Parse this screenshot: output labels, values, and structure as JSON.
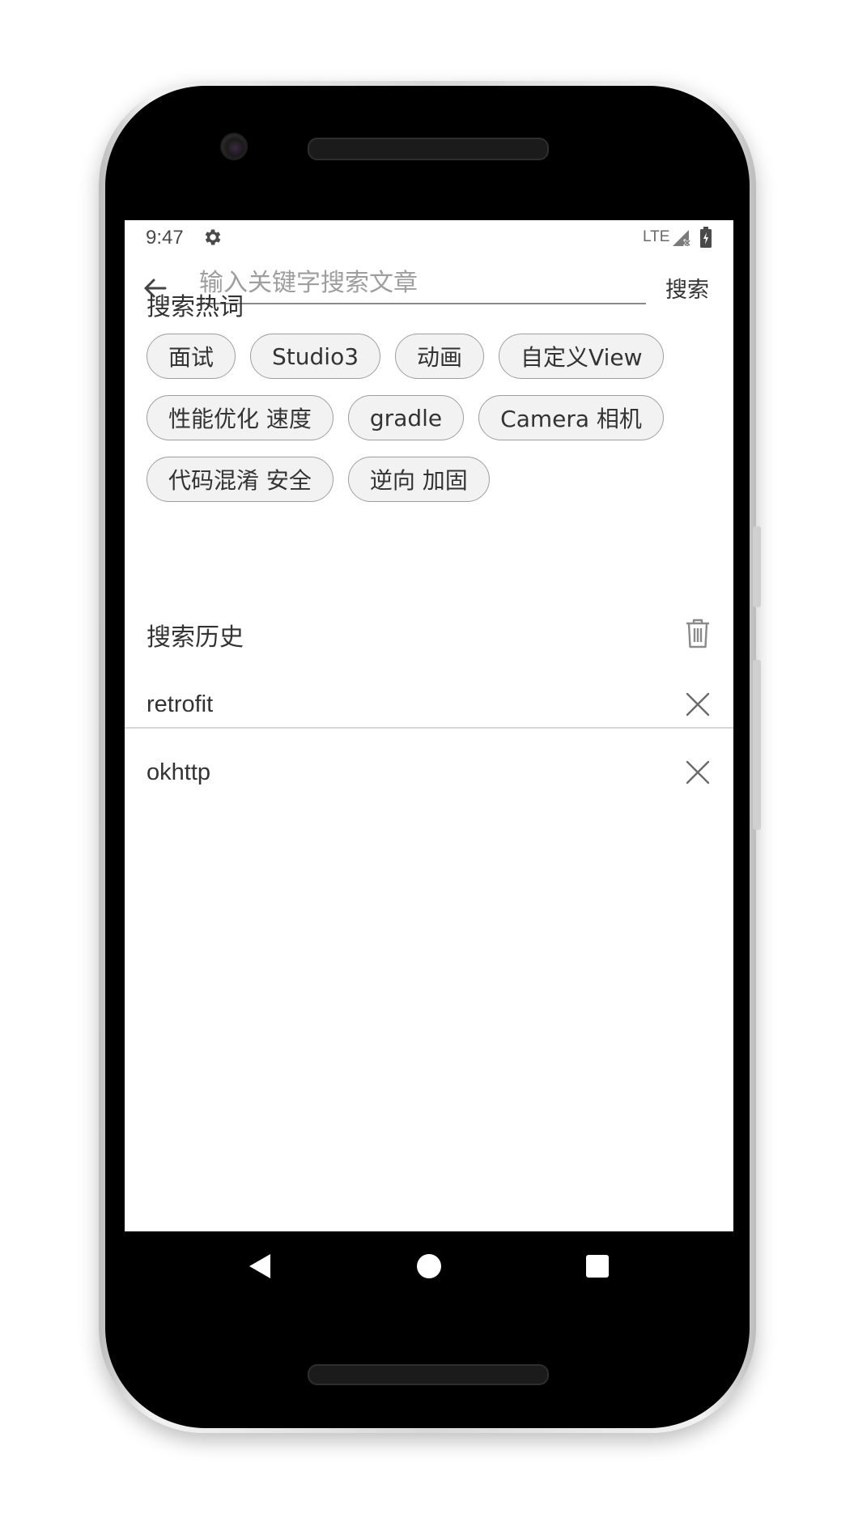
{
  "status_bar": {
    "time": "9:47",
    "network": "LTE",
    "icons": [
      "gear-icon",
      "signal-icon",
      "battery-icon"
    ]
  },
  "toolbar": {
    "back_icon": "arrow-left-icon",
    "search_placeholder": "输入关键字搜索文章",
    "search_value": "",
    "search_label": "搜索"
  },
  "hot_words": {
    "title": "搜索热词",
    "rows": [
      [
        "面试",
        "Studio3",
        "动画",
        "自定义View"
      ],
      [
        "性能优化 速度",
        "gradle",
        "Camera 相机"
      ],
      [
        "代码混淆 安全",
        "逆向 加固"
      ]
    ]
  },
  "history": {
    "title": "搜索历史",
    "clear_icon": "trash-icon",
    "items": [
      {
        "label": "retrofit",
        "remove_icon": "close-icon"
      },
      {
        "label": "okhttp",
        "remove_icon": "close-icon"
      }
    ]
  },
  "navigation_bar": {
    "icons": [
      "back-triangle-icon",
      "home-circle-icon",
      "recents-square-icon"
    ]
  },
  "colors": {
    "chip_background": "#f2f2f2",
    "chip_border": "#9e9e9e",
    "text_primary": "#333333",
    "placeholder": "#9e9e9e",
    "divider": "#d6d6d6"
  }
}
